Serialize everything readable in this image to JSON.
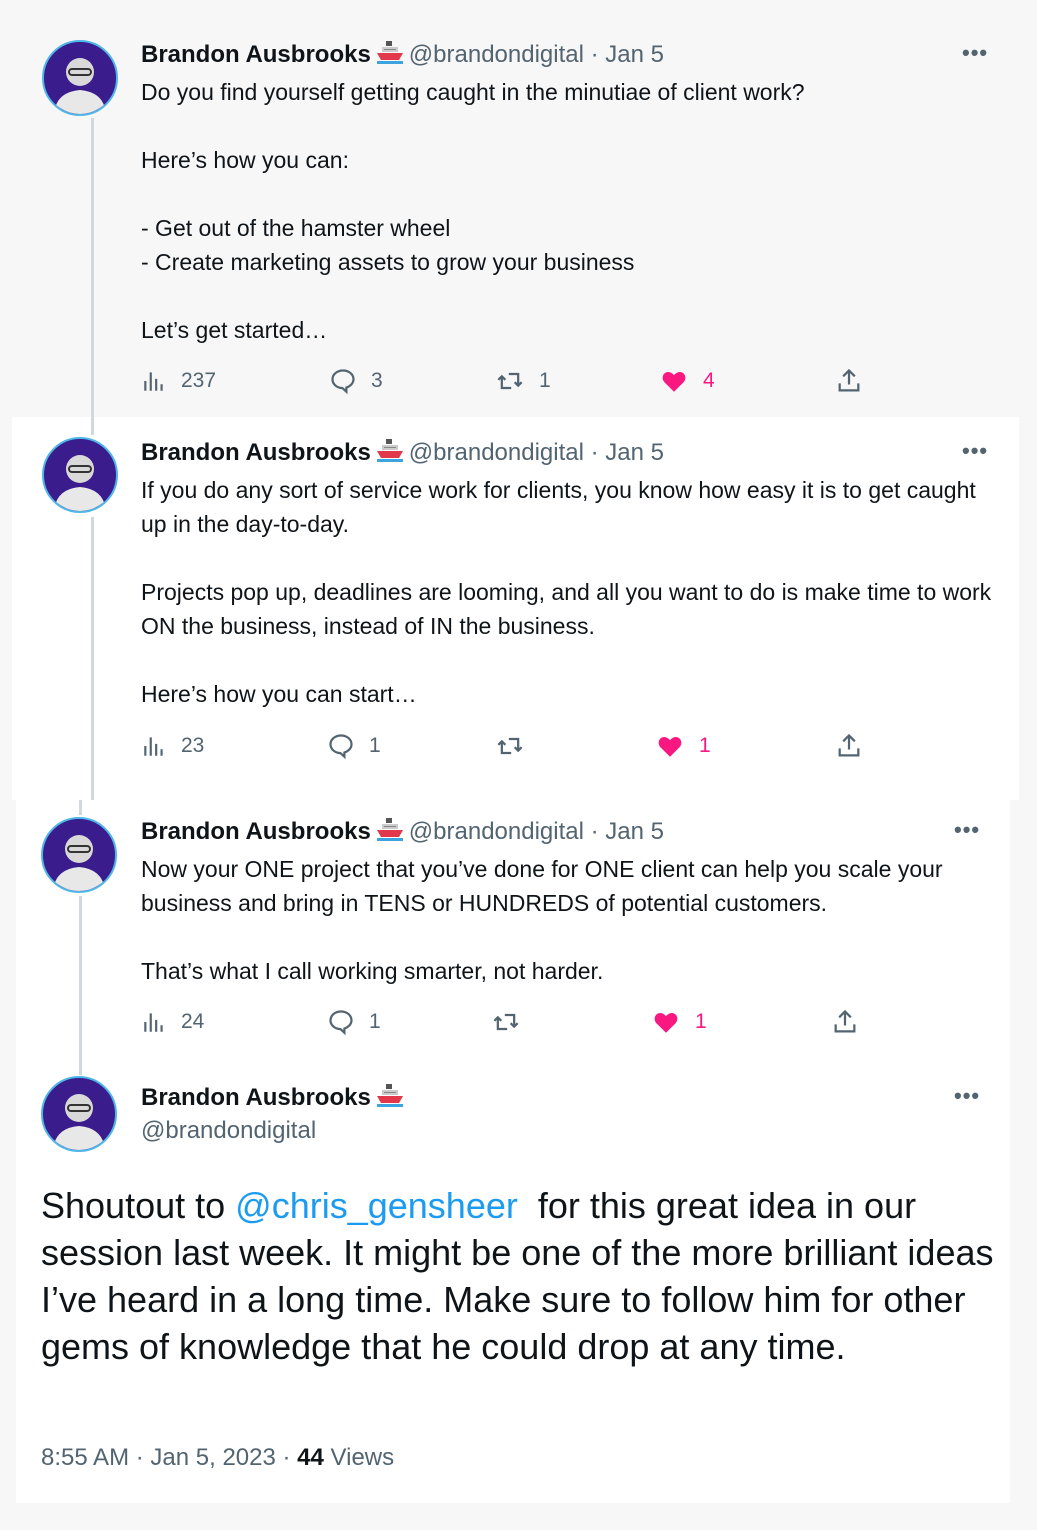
{
  "author": {
    "name": "Brandon Ausbrooks",
    "handle": "@brandondigital",
    "badge_icon": "ship-emoji-icon"
  },
  "tweets": [
    {
      "date": "Jan 5",
      "text": "Do you find yourself getting caught in the minutiae of client work?\n\nHere’s how you can:\n\n- Get out of the hamster wheel\n- Create marketing assets to grow your business\n\nLet’s get started…",
      "views": "237",
      "replies": "3",
      "retweets": "1",
      "likes": "4"
    },
    {
      "date": "Jan 5",
      "text": "If you do any sort of service work for clients, you know how easy it is to get caught up in the day-to-day.\n\nProjects pop up, deadlines are looming, and all you want to do is make time to work ON the business, instead of IN the business.\n\nHere’s how you can start…",
      "views": "23",
      "replies": "1",
      "retweets": "",
      "likes": "1"
    },
    {
      "date": "Jan 5",
      "text": "Now your ONE project that you’ve done for ONE client can help you scale your business and bring in TENS or HUNDREDS of potential customers.\n\nThat’s what I call working smarter, not harder.",
      "views": "24",
      "replies": "1",
      "retweets": "",
      "likes": "1"
    }
  ],
  "main_tweet": {
    "text_before": "Shoutout to ",
    "mention": "@chris_gensheer",
    "text_after": "  for this great idea in our session last week. It might be one of the more brilliant ideas I’ve heard in a long time. Make sure to follow him for other gems of knowledge that he could drop at any time.",
    "time": "8:55 AM",
    "date": "Jan 5, 2023",
    "views_count": "44",
    "views_label": "Views"
  },
  "colors": {
    "like": "#f91880",
    "link": "#1d9bf0",
    "muted": "#536471",
    "avatar_bg": "#3a1c8c",
    "avatar_ring": "#4fb6e8"
  }
}
